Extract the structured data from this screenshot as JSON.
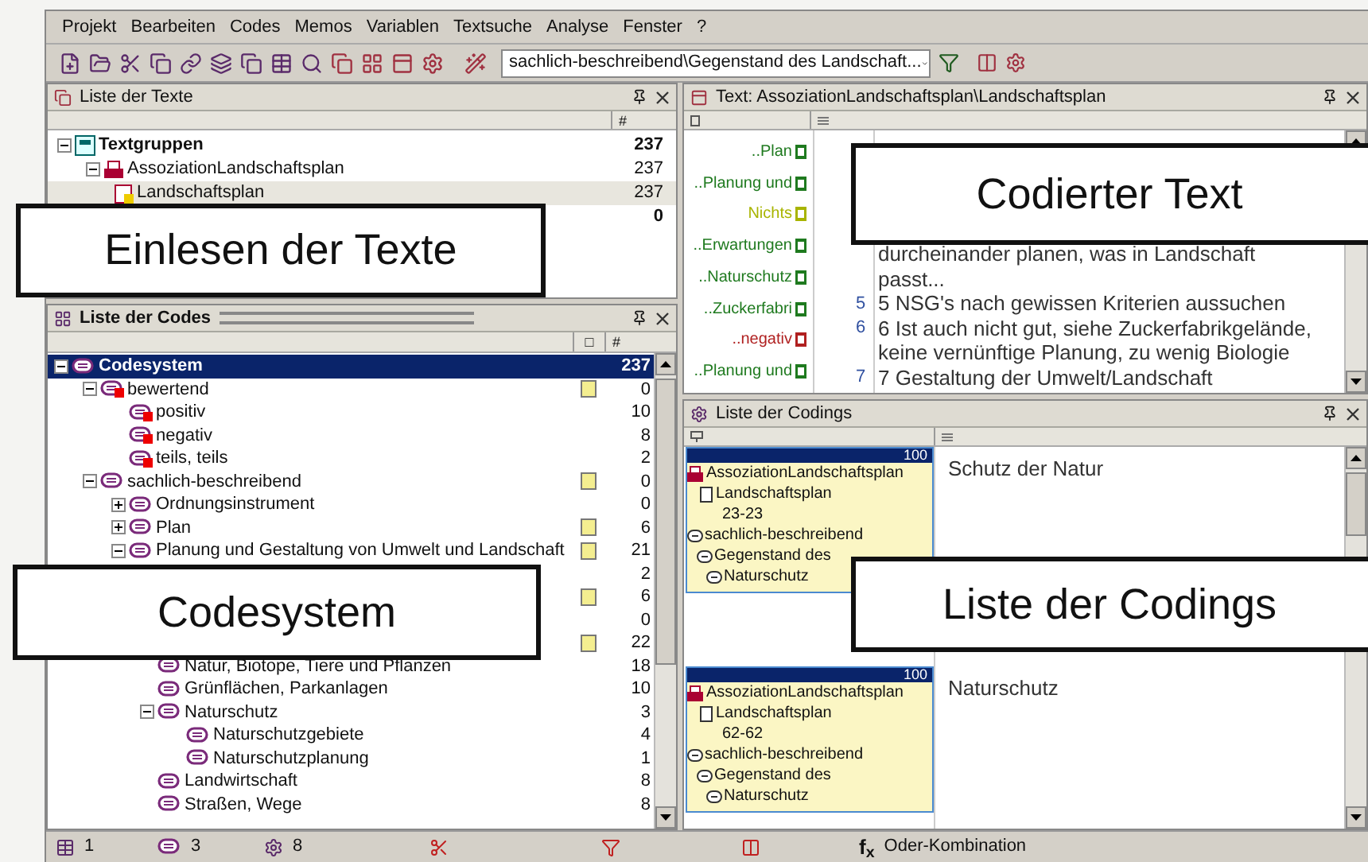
{
  "menu": [
    {
      "label": "Projekt"
    },
    {
      "label": "Bearbeiten"
    },
    {
      "label": "Codes"
    },
    {
      "label": "Memos"
    },
    {
      "label": "Variablen"
    },
    {
      "label": "Textsuche"
    },
    {
      "label": "Analyse"
    },
    {
      "label": "Fenster"
    },
    {
      "label": "?"
    }
  ],
  "toolbar": {
    "code_combo": "sachlich-beschreibend\\Gegenstand des Landschaft..."
  },
  "texts_panel": {
    "title": "Liste der Texte",
    "count_header": "#",
    "callout": "Einlesen der Texte",
    "tree": [
      {
        "kind": "group",
        "name": "Textgruppen",
        "count": "237",
        "bold": true,
        "selected": false,
        "expanded": true,
        "children": [
          {
            "kind": "textgroup",
            "name": "AssoziationLandschaftsplan",
            "count": "237",
            "bold": false,
            "selected": false,
            "expanded": true,
            "children": [
              {
                "kind": "text",
                "name": "Landschaftsplan",
                "count": "237",
                "bold": false,
                "selected": true
              }
            ]
          }
        ]
      },
      {
        "kind": "hidden",
        "count": "0",
        "bold": true,
        "selected": false
      }
    ]
  },
  "codes_panel": {
    "title": "Liste der Codes",
    "memo_header": "□",
    "count_header": "#",
    "callout": "Codesystem",
    "tree": [
      {
        "name": "Codesystem",
        "count": "237",
        "memo": false,
        "red_mark": false,
        "selected": true,
        "expanded": true,
        "children": [
          {
            "name": "bewertend",
            "count": "0",
            "memo": true,
            "red_mark": true,
            "selected": false,
            "expanded": true,
            "children": [
              {
                "name": "positiv",
                "count": "10",
                "memo": false,
                "red_mark": true,
                "selected": false
              },
              {
                "name": "negativ",
                "count": "8",
                "memo": false,
                "red_mark": true,
                "selected": false
              },
              {
                "name": "teils, teils",
                "count": "2",
                "memo": false,
                "red_mark": true,
                "selected": false
              }
            ]
          },
          {
            "name": "sachlich-beschreibend",
            "count": "0",
            "memo": true,
            "red_mark": false,
            "selected": false,
            "expanded": true,
            "children": [
              {
                "name": "Ordnungsinstrument",
                "count": "0",
                "memo": false,
                "red_mark": false,
                "selected": false,
                "expanded": false
              },
              {
                "name": "Plan",
                "count": "6",
                "memo": true,
                "red_mark": false,
                "selected": false,
                "expanded": false
              },
              {
                "name": "Planung und Gestaltung von Umwelt und Landschaft",
                "count": "21",
                "memo": true,
                "red_mark": false,
                "selected": false,
                "expanded": true,
                "children": [
                  {
                    "count": "2",
                    "memo": false,
                    "selected": false
                  },
                  {
                    "count": "6",
                    "memo": true,
                    "selected": false
                  },
                  {
                    "count": "0",
                    "memo": false,
                    "selected": false
                  }
                ]
              },
              {
                "count": "22",
                "memo": true,
                "selected": false,
                "children": [
                  {
                    "name": "Natur, Biotope, Tiere und Pflanzen",
                    "count": "18",
                    "memo": false,
                    "red_mark": false,
                    "selected": false
                  },
                  {
                    "name": "Grünflächen, Parkanlagen",
                    "count": "10",
                    "memo": false,
                    "red_mark": false,
                    "selected": false
                  },
                  {
                    "name": "Naturschutz",
                    "count": "3",
                    "memo": false,
                    "red_mark": false,
                    "selected": false,
                    "expanded": true,
                    "children": [
                      {
                        "name": "Naturschutzgebiete",
                        "count": "4",
                        "memo": false,
                        "red_mark": false,
                        "selected": false
                      },
                      {
                        "name": "Naturschutzplanung",
                        "count": "1",
                        "memo": false,
                        "red_mark": false,
                        "selected": false
                      }
                    ]
                  },
                  {
                    "name": "Landwirtschaft",
                    "count": "8",
                    "memo": false,
                    "red_mark": false,
                    "selected": false
                  },
                  {
                    "name": "Straßen, Wege",
                    "count": "8",
                    "memo": false,
                    "red_mark": false,
                    "selected": false
                  }
                ]
              }
            ]
          }
        ]
      }
    ]
  },
  "text_panel": {
    "title": "Text: AssoziationLandschaftsplan\\Landschaftsplan",
    "callout": "Codierter Text",
    "code_marks": [
      {
        "label": "..Plan",
        "color": "#1f7a1f"
      },
      {
        "label": "..Planung und",
        "color": "#1f7a1f"
      },
      {
        "label": "Nichts",
        "color": "#a8b400"
      },
      {
        "label": "..Erwartungen",
        "color": "#1f7a1f"
      },
      {
        "label": "..Naturschutz",
        "color": "#1f7a1f"
      },
      {
        "label": "..Zuckerfabri",
        "color": "#1f7a1f"
      },
      {
        "label": "..negativ",
        "color": "#b02020"
      },
      {
        "label": "..Planung und",
        "color": "#1f7a1f"
      }
    ],
    "lines": [
      {
        "text": "durcheinander planen, was in Landschaft"
      },
      {
        "text": "passt..."
      },
      {
        "number": "5",
        "text": "5 NSG's nach gewissen Kriterien aussuchen"
      },
      {
        "number": "6",
        "text": "6 Ist auch nicht gut, siehe Zuckerfabrikgelände,"
      },
      {
        "text": "keine vernünftige Planung, zu wenig Biologie"
      },
      {
        "number": "7",
        "text": "7 Gestaltung der Umwelt/Landschaft"
      }
    ]
  },
  "codings_panel": {
    "title": "Liste der Codings",
    "callout": "Liste der Codings",
    "codings": [
      {
        "score": "100",
        "text_group": "AssoziationLandschaftsplan",
        "text": "Landschaftsplan",
        "range": "23-23",
        "codes": [
          "sachlich-beschreibend",
          "Gegenstand des",
          "Naturschutz"
        ],
        "segment": "Schutz der Natur"
      },
      {
        "score": "100",
        "text_group": "AssoziationLandschaftsplan",
        "text": "Landschaftsplan",
        "range": "62-62",
        "codes": [
          "sachlich-beschreibend",
          "Gegenstand des",
          "Naturschutz"
        ],
        "segment": "Naturschutz"
      }
    ]
  },
  "status_bar": {
    "texts": "1",
    "codes": "3",
    "codings": "8",
    "formula_glyph": "f$_{x}$",
    "formula": "Oder-Kombination"
  }
}
